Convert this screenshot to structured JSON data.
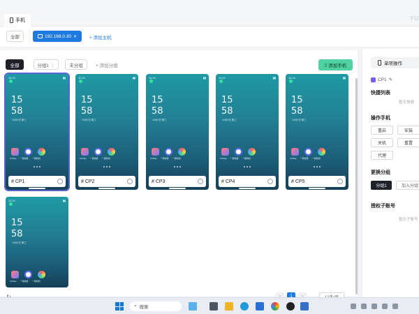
{
  "app_tab": {
    "label": "手机"
  },
  "brand": "YU",
  "hostbar": {
    "all_label": "全部",
    "host_ip": "192.168.0.30",
    "add_host_label": "+ 添加主机"
  },
  "filters": {
    "all_label": "全部",
    "group1_label": "分组1 ⋮",
    "ungrouped_label": "未分组",
    "add_group_label": "+ 添加分组",
    "add_phone_label": "添加手机"
  },
  "phone_screen": {
    "status_time": "11:24",
    "clock_hour": "15",
    "clock_min": "58",
    "date_text": "10月9日 周三",
    "app_names": [
      "ChPlay",
      "一键恢复",
      "一键新机"
    ]
  },
  "cards": [
    {
      "name": "# CP1"
    },
    {
      "name": "# CP2"
    },
    {
      "name": "# CP3"
    },
    {
      "name": "# CP4"
    },
    {
      "name": "# CP5"
    }
  ],
  "pagination": {
    "prev": "‹",
    "current": "1",
    "next": "›",
    "page_size": "12条/页"
  },
  "rpanel": {
    "tab_label": "单项操作",
    "selected_device": "CP1",
    "shortcuts_title": "快捷列表",
    "shortcuts_empty": "暂无快捷",
    "ops_title": "操作手机",
    "ops": [
      "重启",
      "安装",
      "关机",
      "重置",
      "代理"
    ],
    "change_group_title": "更换分组",
    "group_current": "分组1",
    "group_add": "加入分组",
    "auth_title": "授权子账号",
    "auth_empty": "暂无子账号"
  },
  "taskbar": {
    "search_placeholder": "搜索"
  },
  "colors": {
    "accent": "#1f7ae0",
    "add_phone": "#4fd1a1",
    "selected_outline": "#5a63d6"
  }
}
